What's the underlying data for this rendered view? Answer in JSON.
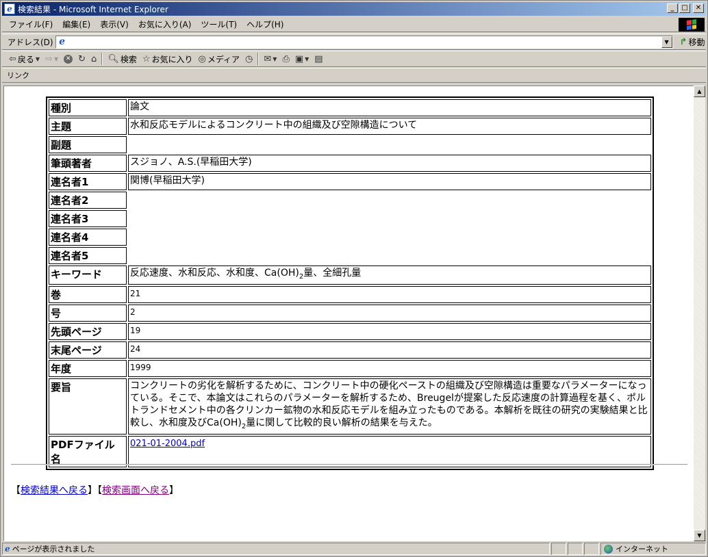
{
  "window": {
    "title": "検索結果 - Microsoft Internet Explorer"
  },
  "menu": [
    "ファイル(F)",
    "編集(E)",
    "表示(V)",
    "お気に入り(A)",
    "ツール(T)",
    "ヘルプ(H)"
  ],
  "address": {
    "label": "アドレス(D)",
    "value": "",
    "go_label": "移動"
  },
  "toolbar": {
    "back": "戻る",
    "search": "検索",
    "favorites": "お気に入り",
    "media": "メディア"
  },
  "links": {
    "label": "リンク"
  },
  "record": {
    "rows": [
      {
        "label": "種別",
        "value": "論文"
      },
      {
        "label": "主題",
        "value": "水和反応モデルによるコンクリート中の組織及び空隙構造について"
      },
      {
        "label": "副題",
        "value": ""
      },
      {
        "label": "筆頭著者",
        "value": "スジョノ、A.S.(早稲田大学)"
      },
      {
        "label": "連名者1",
        "value": "関博(早稲田大学)"
      },
      {
        "label": "連名者2",
        "value": ""
      },
      {
        "label": "連名者3",
        "value": ""
      },
      {
        "label": "連名者4",
        "value": ""
      },
      {
        "label": "連名者5",
        "value": ""
      },
      {
        "label": "キーワード",
        "value_pre": "反応速度、水和反応、水和度、Ca(OH)",
        "value_sub": "2",
        "value_post": "量、全細孔量"
      },
      {
        "label": "巻",
        "value": "21"
      },
      {
        "label": "号",
        "value": "2"
      },
      {
        "label": "先頭ページ",
        "value": "19"
      },
      {
        "label": "末尾ページ",
        "value": "24"
      },
      {
        "label": "年度",
        "value": "1999"
      },
      {
        "label": "要旨",
        "value_pre": "コンクリートの劣化を解析するために、コンクリート中の硬化ペーストの組織及び空隙構造は重要なパラメーターになっている。そこで、本論文はこれらのパラメーターを解析するため、Breugelが提案した反応速度の計算過程を基く、ポルトランドセメント中の各クリンカー鉱物の水和反応モデルを組み立ったものである。本解析を既往の研究の実験結果と比較し、水和度及びCa(OH)",
        "value_sub": "2",
        "value_post": "量に関して比較的良い解析の結果を与えた。"
      },
      {
        "label": "PDFファイル名",
        "link": "021-01-2004.pdf"
      }
    ]
  },
  "nav": {
    "bracket_open": "【",
    "bracket_close": "】",
    "back_to_results": "検索結果へ戻る",
    "back_to_search": "検索画面へ戻る"
  },
  "status": {
    "message": "ページが表示されました",
    "zone": "インターネット"
  }
}
